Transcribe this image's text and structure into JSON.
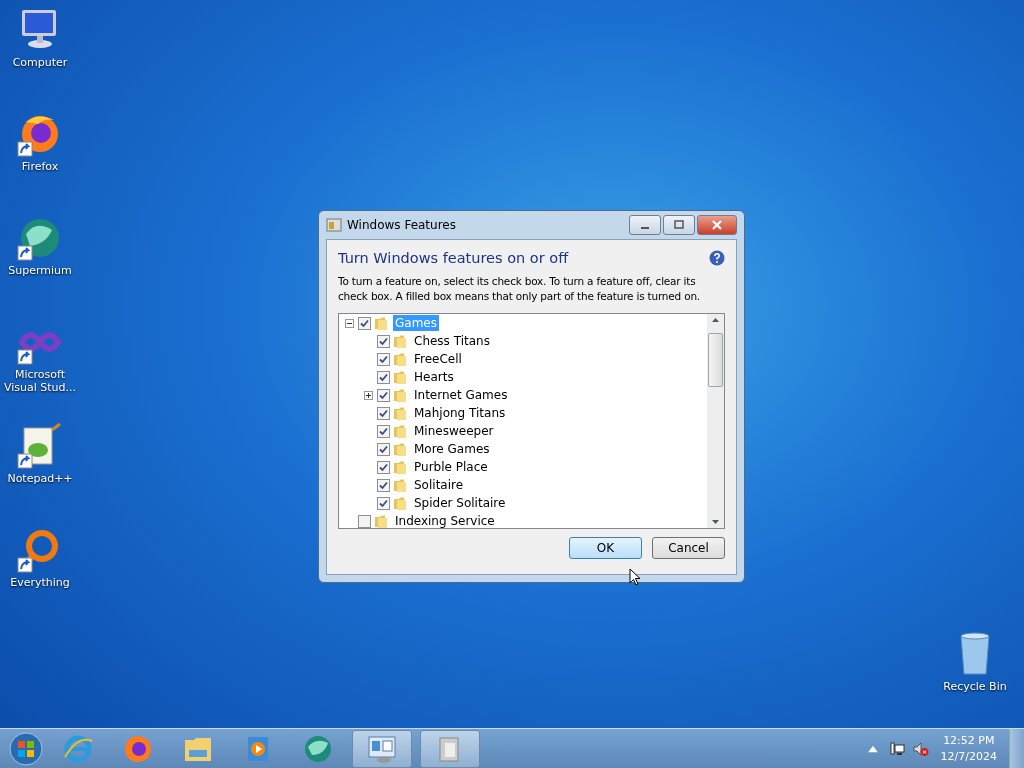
{
  "desktop_icons": [
    {
      "label": "Computer",
      "kind": "computer",
      "shortcut": false
    },
    {
      "label": "Firefox",
      "kind": "firefox",
      "shortcut": true
    },
    {
      "label": "Supermium",
      "kind": "supermium",
      "shortcut": true
    },
    {
      "label": "Microsoft Visual Stud...",
      "kind": "vs",
      "shortcut": true
    },
    {
      "label": "Notepad++",
      "kind": "notepad",
      "shortcut": true
    },
    {
      "label": "Everything",
      "kind": "everything",
      "shortcut": true
    }
  ],
  "recycle_bin": {
    "label": "Recycle Bin"
  },
  "dialog": {
    "title": "Windows Features",
    "heading": "Turn Windows features on or off",
    "description": "To turn a feature on, select its check box. To turn a feature off, clear its check box. A filled box means that only part of the feature is turned on.",
    "tree": [
      {
        "label": "Games",
        "checked": true,
        "selected": true,
        "expanded": true,
        "children": [
          {
            "label": "Chess Titans",
            "checked": true,
            "selected": false
          },
          {
            "label": "FreeCell",
            "checked": true,
            "selected": false
          },
          {
            "label": "Hearts",
            "checked": true,
            "selected": false
          },
          {
            "label": "Internet Games",
            "checked": true,
            "selected": false,
            "expanded": false
          },
          {
            "label": "Mahjong Titans",
            "checked": true,
            "selected": false
          },
          {
            "label": "Minesweeper",
            "checked": true,
            "selected": false
          },
          {
            "label": "More Games",
            "checked": true,
            "selected": false
          },
          {
            "label": "Purble Place",
            "checked": true,
            "selected": false
          },
          {
            "label": "Solitaire",
            "checked": true,
            "selected": false
          },
          {
            "label": "Spider Solitaire",
            "checked": true,
            "selected": false
          }
        ]
      },
      {
        "label": "Indexing Service",
        "checked": false,
        "selected": false
      }
    ],
    "buttons": [
      {
        "label": "OK",
        "default": true
      },
      {
        "label": "Cancel",
        "default": false
      }
    ]
  },
  "taskbar": {
    "pinned": [
      {
        "kind": "ie"
      },
      {
        "kind": "firefox"
      },
      {
        "kind": "explorer"
      },
      {
        "kind": "media"
      },
      {
        "kind": "supermium"
      }
    ],
    "windows": [
      {
        "kind": "control-panel"
      },
      {
        "kind": "features"
      }
    ],
    "clock": {
      "time": "12:52 PM",
      "date": "12/7/2024"
    }
  }
}
